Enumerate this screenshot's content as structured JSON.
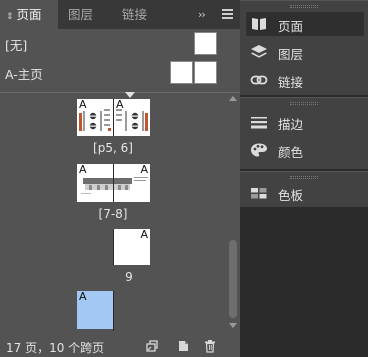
{
  "pages_panel": {
    "tabs": [
      {
        "label": "页面",
        "active": true
      },
      {
        "label": "图层",
        "active": false
      },
      {
        "label": "链接",
        "active": false
      }
    ],
    "more_glyph": "››",
    "masters": [
      {
        "label": "[无]"
      },
      {
        "label": "A-主页"
      }
    ],
    "master_prefix": "A",
    "spreads": [
      {
        "label": "[p5, 6]"
      },
      {
        "label": "[7-8]"
      },
      {
        "label": "9"
      }
    ],
    "status_text": "17 页，10 个跨页",
    "colors": {
      "panel_bg": "#535353",
      "tab_bar_bg": "#383838",
      "selected_page": "#a3c8f4",
      "page_white": "#ffffff"
    }
  },
  "dock": {
    "groups": [
      {
        "items": [
          {
            "label": "页面",
            "icon": "pages-icon",
            "active": true
          },
          {
            "label": "图层",
            "icon": "layers-icon",
            "active": false
          },
          {
            "label": "链接",
            "icon": "links-icon",
            "active": false
          }
        ]
      },
      {
        "items": [
          {
            "label": "描边",
            "icon": "stroke-icon",
            "active": false
          },
          {
            "label": "颜色",
            "icon": "color-palette-icon",
            "active": false
          }
        ]
      },
      {
        "items": [
          {
            "label": "色板",
            "icon": "swatches-icon",
            "active": false
          }
        ]
      }
    ]
  }
}
